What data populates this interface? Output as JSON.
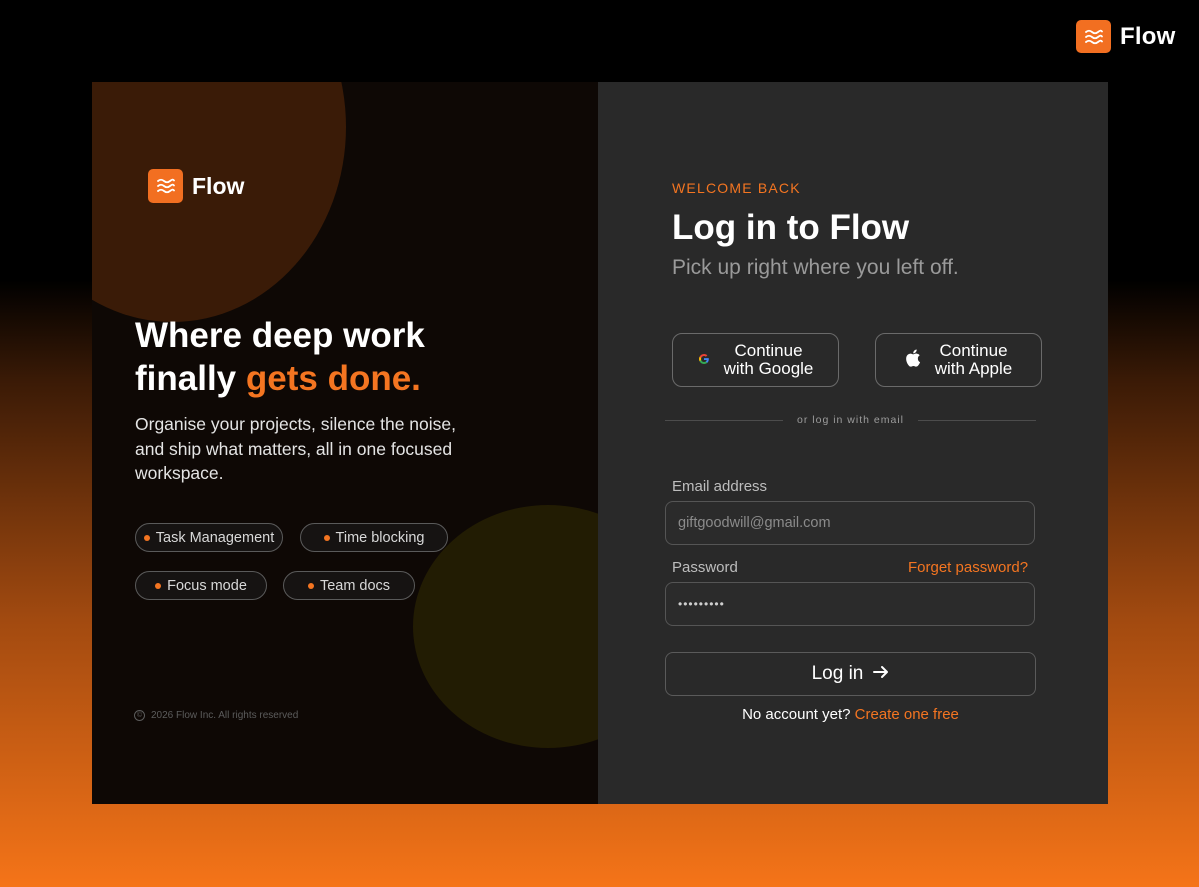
{
  "brand": {
    "name": "Flow",
    "accent_color": "#f26f21"
  },
  "hero": {
    "headline_line1": "Where deep work",
    "headline_plain": "finally ",
    "headline_accent": "gets done.",
    "description": "Organise your projects, silence the noise, and ship what matters, all in one focused workspace.",
    "features": [
      "Task Management",
      "Time blocking",
      "Focus mode",
      "Team docs"
    ],
    "copyright": "2026 Flow Inc. All rights reserved"
  },
  "login": {
    "eyebrow": "WELCOME BACK",
    "title": "Log in to Flow",
    "subtitle": "Pick up right where you left off.",
    "google": {
      "line1": "Continue",
      "line2": "with Google"
    },
    "apple": {
      "line1": "Continue",
      "line2": "with Apple"
    },
    "divider_text": "or log in with email",
    "email_label": "Email address",
    "email_placeholder": "giftgoodwill@gmail.com",
    "password_label": "Password",
    "forgot_label": "Forget password?",
    "password_value": "•••••••••",
    "submit_label": "Log in",
    "signup_prompt": "No account yet?",
    "signup_link": "Create one free"
  },
  "icons": {
    "logo": "waves-icon",
    "google": "google-icon",
    "apple": "apple-icon",
    "arrow": "arrow-right-icon",
    "copyright": "copyright-icon"
  }
}
